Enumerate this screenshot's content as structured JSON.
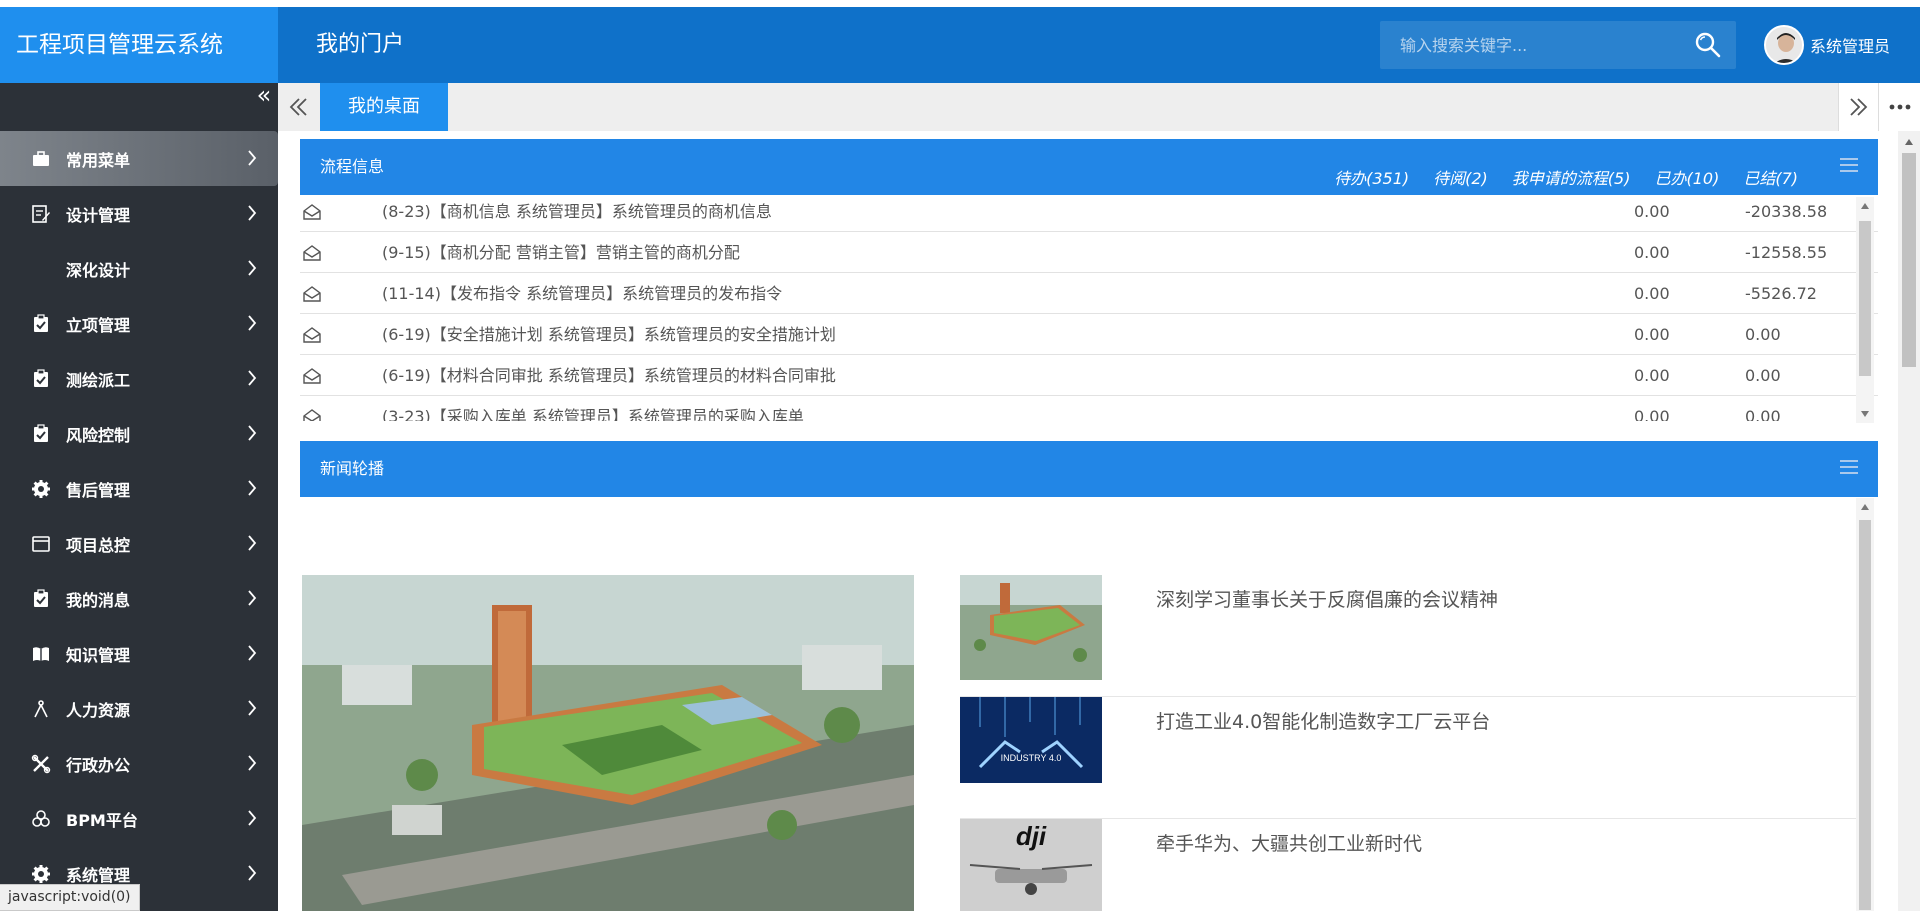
{
  "app": {
    "title": "工程项目管理云系统",
    "portal_title": "我的门户"
  },
  "search": {
    "placeholder": "输入搜索关键字..."
  },
  "user": {
    "name": "系统管理员"
  },
  "sidebar": {
    "items": [
      {
        "label": "常用菜单",
        "icon": "briefcase-icon"
      },
      {
        "label": "设计管理",
        "icon": "edit-icon"
      },
      {
        "label": "深化设计",
        "icon": ""
      },
      {
        "label": "立项管理",
        "icon": "clipboard-check-icon"
      },
      {
        "label": "测绘派工",
        "icon": "clipboard-check-icon"
      },
      {
        "label": "风险控制",
        "icon": "clipboard-check-icon"
      },
      {
        "label": "售后管理",
        "icon": "gear-icon"
      },
      {
        "label": "项目总控",
        "icon": "window-icon"
      },
      {
        "label": "我的消息",
        "icon": "clipboard-check-icon"
      },
      {
        "label": "知识管理",
        "icon": "book-icon"
      },
      {
        "label": "人力资源",
        "icon": "compass-icon"
      },
      {
        "label": "行政办公",
        "icon": "tools-icon"
      },
      {
        "label": "BPM平台",
        "icon": "cubes-icon"
      },
      {
        "label": "系统管理",
        "icon": "gear-icon"
      }
    ]
  },
  "tabs": {
    "active_label": "我的桌面"
  },
  "flow": {
    "title": "流程信息",
    "tabs": [
      "待办(351)",
      "待阅(2)",
      "我申请的流程(5)",
      "已办(10)",
      "已结(7)"
    ],
    "rows": [
      {
        "text": "(8-23)【商机信息 系统管理员】系统管理员的商机信息",
        "v1": "0.00",
        "v2": "-20338.58"
      },
      {
        "text": "(9-15)【商机分配 营销主管】营销主管的商机分配",
        "v1": "0.00",
        "v2": "-12558.55"
      },
      {
        "text": "(11-14)【发布指令 系统管理员】系统管理员的发布指令",
        "v1": "0.00",
        "v2": "-5526.72"
      },
      {
        "text": "(6-19)【安全措施计划 系统管理员】系统管理员的安全措施计划",
        "v1": "0.00",
        "v2": "0.00"
      },
      {
        "text": "(6-19)【材料合同审批 系统管理员】系统管理员的材料合同审批",
        "v1": "0.00",
        "v2": "0.00"
      },
      {
        "text": "(3-23)【采购入库单 系统管理员】系统管理员的采购入库单",
        "v1": "0.00",
        "v2": "0.00"
      }
    ]
  },
  "news": {
    "title": "新闻轮播",
    "items": [
      {
        "title": "深刻学习董事长关于反腐倡廉的会议精神"
      },
      {
        "title": "打造工业4.0智能化制造数字工厂云平台",
        "thumb_text": "INDUSTRY 4.0"
      },
      {
        "title": "牵手华为、大疆共创工业新时代",
        "thumb_text": "dji"
      }
    ]
  },
  "status": {
    "text": "javascript:void(0)"
  },
  "colors": {
    "header": "#0f71c9",
    "brand": "#1f8fee",
    "sidebar": "#2c3138",
    "panel_head": "#2286e6"
  }
}
